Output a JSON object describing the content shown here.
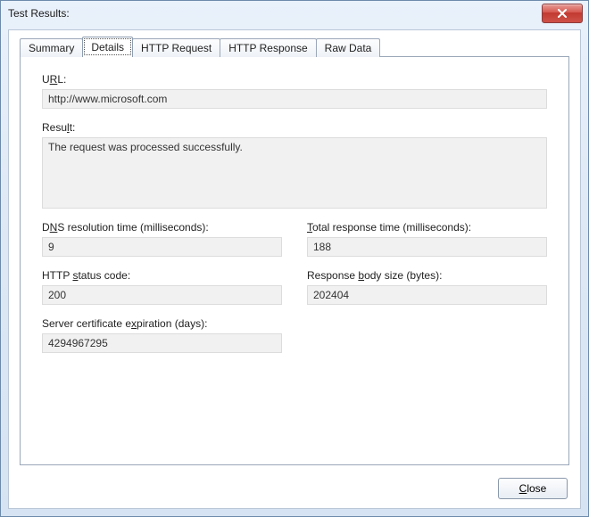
{
  "window": {
    "title": "Test Results:"
  },
  "tabs": {
    "summary": "Summary",
    "details": "Details",
    "http_request": "HTTP Request",
    "http_response": "HTTP Response",
    "raw_data": "Raw Data"
  },
  "labels": {
    "url_pre": "U",
    "url_u": "R",
    "url_post": "L:",
    "result_pre": "Resu",
    "result_u": "l",
    "result_post": "t:",
    "dns_pre": "D",
    "dns_u": "N",
    "dns_post": "S resolution time (milliseconds):",
    "total_u": "T",
    "total_post": "otal response time (milliseconds):",
    "http_pre": "HTTP ",
    "http_u": "s",
    "http_post": "tatus code:",
    "body_pre": "Response ",
    "body_u": "b",
    "body_post": "ody size (bytes):",
    "cert_pre": "Server certificate e",
    "cert_u": "x",
    "cert_post": "piration (days):"
  },
  "values": {
    "url": "http://www.microsoft.com",
    "result": "The request was processed successfully.",
    "dns_ms": "9",
    "total_ms": "188",
    "http_status": "200",
    "body_size": "202404",
    "cert_days": "4294967295"
  },
  "footer": {
    "close_u": "C",
    "close_post": "lose"
  }
}
